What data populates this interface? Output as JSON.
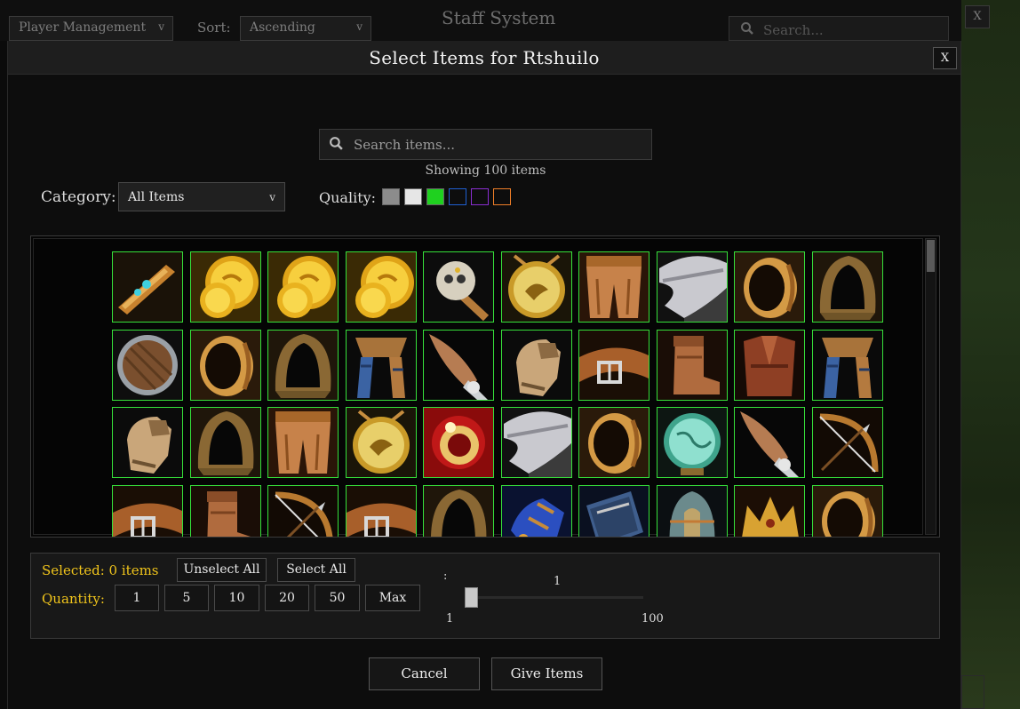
{
  "background": {
    "player_dropdown": "Player Management",
    "sort_label": "Sort:",
    "sort_value": "Ascending",
    "title": "Staff System",
    "search_placeholder": "Search...",
    "close_label": "X"
  },
  "modal": {
    "title": "Select Items for Rtshuilo",
    "close_label": "X",
    "search_placeholder": "Search items...",
    "showing_text": "Showing 100 items",
    "category_label": "Category:",
    "category_value": "All Items",
    "quality_label": "Quality:",
    "quality_colors": [
      "#8c8c8c",
      "#e6e6e6",
      "#1fd11f",
      "#1f5fd1",
      "#8a2ed1",
      "#f07f28"
    ]
  },
  "items": [
    [
      "horn-item-icon",
      "gold-coins-item-icon",
      "gold-coins-item-icon",
      "gold-coins-item-icon",
      "skull-scepter-item-icon",
      "gold-medallion-item-icon",
      "leather-leggings-item-icon",
      "cloth-shoulder-item-icon",
      "bronze-bracer-item-icon",
      "hood-item-icon"
    ],
    [
      "round-shield-item-icon",
      "bronze-bracer-item-icon",
      "hood-item-icon",
      "scarf-item-icon",
      "feathered-wand-item-icon",
      "gauntlet-item-icon",
      "belt-item-icon",
      "leather-boot-item-icon",
      "leather-armor-item-icon",
      "scarf-item-icon"
    ],
    [
      "gauntlet-item-icon",
      "hood-item-icon",
      "leather-leggings-item-icon",
      "gold-medallion-item-icon",
      "gold-ring-item-icon",
      "cloth-shoulder-item-icon",
      "bronze-bracer-item-icon",
      "crystal-orb-item-icon",
      "feathered-wand-item-icon",
      "bow-item-icon"
    ],
    [
      "belt-item-icon",
      "leather-boot-item-icon",
      "bow-item-icon",
      "belt-item-icon",
      "hood-item-icon",
      "blue-glove-item-icon",
      "spellbook-item-icon",
      "helm-item-icon",
      "golden-crown-item-icon",
      "bronze-bracer-item-icon"
    ]
  ],
  "footer": {
    "selected_text": "Selected: 0 items",
    "unselect_all": "Unselect All",
    "select_all": "Select All",
    "quantity_label": "Quantity:",
    "quantity_options": [
      "1",
      "5",
      "10",
      "20",
      "50",
      "Max"
    ],
    "slider_label": ":",
    "slider_value": "1",
    "slider_min": "1",
    "slider_max": "100",
    "cancel": "Cancel",
    "give_items": "Give Items"
  }
}
